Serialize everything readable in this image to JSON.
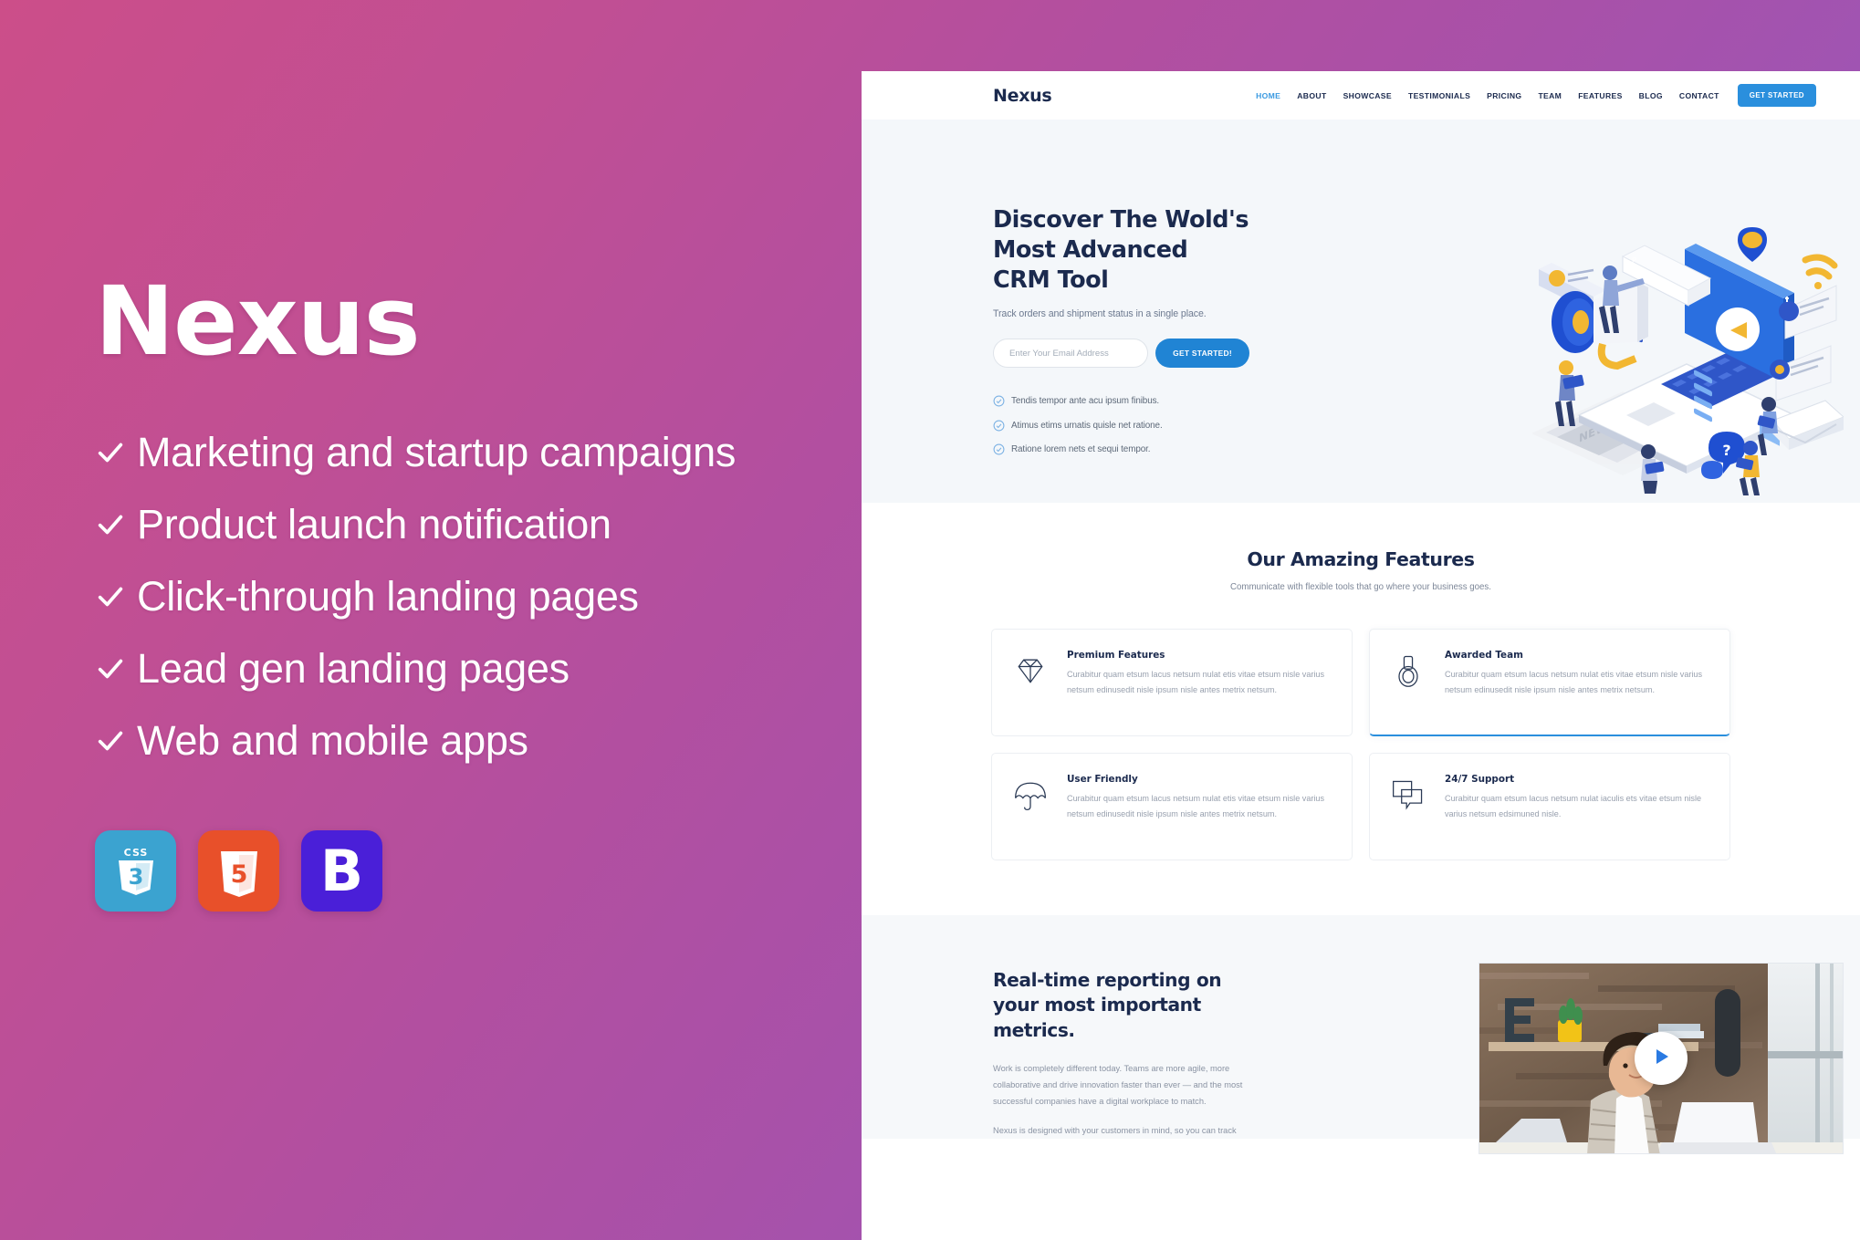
{
  "promo": {
    "title": "Nexus",
    "features": [
      "Marketing and startup campaigns",
      "Product launch notification",
      "Click-through landing pages",
      "Lead gen landing pages",
      "Web and mobile apps"
    ],
    "badges": [
      {
        "name": "css3",
        "label": "CSS3",
        "color": "#3BA3D0"
      },
      {
        "name": "html5",
        "label": "HTML5",
        "color": "#E8502A"
      },
      {
        "name": "bootstrap",
        "label": "B",
        "color": "#4A1FD8"
      }
    ]
  },
  "site": {
    "logo": "Nexus",
    "nav": [
      {
        "label": "HOME",
        "active": true
      },
      {
        "label": "ABOUT",
        "active": false
      },
      {
        "label": "SHOWCASE",
        "active": false
      },
      {
        "label": "TESTIMONIALS",
        "active": false
      },
      {
        "label": "PRICING",
        "active": false
      },
      {
        "label": "TEAM",
        "active": false
      },
      {
        "label": "FEATURES",
        "active": false
      },
      {
        "label": "BLOG",
        "active": false
      },
      {
        "label": "CONTACT",
        "active": false
      }
    ],
    "nav_cta": "GET STARTED",
    "hero": {
      "heading": "Discover The Wold's Most Advanced CRM Tool",
      "subheading": "Track orders and shipment status in a single place.",
      "email_placeholder": "Enter Your Email Address",
      "email_value": "",
      "submit_label": "GET STARTED!",
      "points": [
        "Tendis tempor ante acu ipsum finibus.",
        "Atimus etims urnatis quisle net ratione.",
        "Ratione lorem nets et sequi tempor."
      ]
    },
    "features": {
      "title": "Our Amazing Features",
      "subtitle": "Communicate with flexible tools that go where your business goes.",
      "cards": [
        {
          "icon": "diamond-icon",
          "title": "Premium Features",
          "text": "Curabitur quam etsum lacus netsum nulat etis vitae etsum nisle varius netsum edinusedit nisle ipsum nisle antes metrix netsum.",
          "active": false
        },
        {
          "icon": "medal-icon",
          "title": "Awarded Team",
          "text": "Curabitur quam etsum lacus netsum nulat etis vitae etsum nisle varius netsum edinusedit nisle ipsum nisle antes metrix netsum.",
          "active": true
        },
        {
          "icon": "umbrella-icon",
          "title": "User Friendly",
          "text": "Curabitur quam etsum lacus netsum nulat etis vitae etsum nisle varius netsum edinusedit nisle ipsum nisle antes metrix netsum.",
          "active": false
        },
        {
          "icon": "chat-icon",
          "title": "24/7 Support",
          "text": "Curabitur quam etsum lacus netsum nulat iaculis ets vitae etsum nisle varius netsum edsimuned nisle.",
          "active": false
        }
      ]
    },
    "report": {
      "heading": "Real-time reporting on your most important metrics.",
      "paragraph1": "Work is completely different today. Teams are more agile, more collaborative and drive innovation faster than ever — and the most successful companies have a digital workplace to match.",
      "paragraph2": "Nexus is designed with your customers in mind, so you can track"
    }
  },
  "colors": {
    "accent_blue": "#2A8FDD",
    "dark_navy": "#1B2A4E",
    "muted_text": "#98A0AE",
    "hero_bg": "#F4F7FA",
    "gradient_start": "#CC4E89",
    "gradient_end": "#9558BC"
  }
}
